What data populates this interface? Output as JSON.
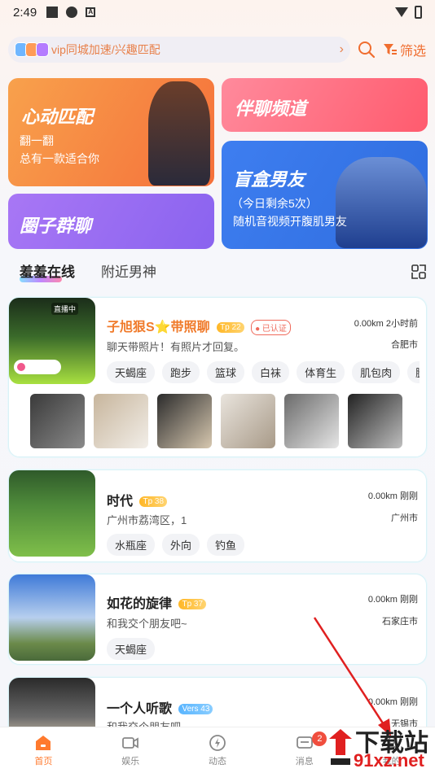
{
  "status_bar": {
    "time": "2:49",
    "small_icon": "A"
  },
  "search": {
    "text": "vip同城加速/兴趣匹配",
    "arrow": "›"
  },
  "filter": {
    "label": "筛选",
    "color": "#f06d2e"
  },
  "cards": {
    "heart_match": {
      "title": "心动匹配",
      "line1": "翻一翻",
      "line2": "总有一款适合你"
    },
    "chat_channel": {
      "title": "伴聊频道"
    },
    "blind_box": {
      "title": "盲盒男友",
      "line1": "（今日剩余5次）",
      "line2": "随机音视频开腹肌男友"
    },
    "circle_chat": {
      "title": "圈子群聊"
    }
  },
  "tabs": {
    "active": "羞羞在线",
    "inactive": "附近男神"
  },
  "users": [
    {
      "name": "子旭狠S⭐带照聊",
      "badge": "Tp",
      "level": "22",
      "certified": "已认证",
      "live": "直播中",
      "bio": "聊天带照片！有照片才回复。",
      "distance": "0.00km 2小时前",
      "city": "合肥市",
      "tags": [
        "天蝎座",
        "跑步",
        "篮球",
        "白袜",
        "体育生",
        "肌包肉",
        "腿"
      ]
    },
    {
      "name": "时代",
      "badge": "Tp",
      "level": "38",
      "bio": "广州市荔湾区，1",
      "distance": "0.00km 刚刚",
      "city": "广州市",
      "tags": [
        "水瓶座",
        "外向",
        "钓鱼"
      ]
    },
    {
      "name": "如花的旋律",
      "badge": "Tp",
      "level": "37",
      "bio": "和我交个朋友吧~",
      "distance": "0.00km 刚刚",
      "city": "石家庄市",
      "tags": [
        "天蝎座"
      ]
    },
    {
      "name": "一个人听歌",
      "badge": "Vers",
      "level": "43",
      "bio": "和我交个朋友吧~",
      "distance": "0.00km 刚刚",
      "city": "无锡市",
      "tags": []
    }
  ],
  "nav": [
    {
      "label": "首页",
      "icon": "home-icon",
      "active": true
    },
    {
      "label": "娱乐",
      "icon": "video-icon",
      "active": false
    },
    {
      "label": "动态",
      "icon": "lightning-icon",
      "active": false
    },
    {
      "label": "消息",
      "icon": "message-icon",
      "active": false,
      "badge": "2"
    },
    {
      "label": "我的",
      "icon": "profile-icon",
      "active": false
    }
  ],
  "watermark": {
    "line1": "下载站",
    "line2": "91xz.net"
  }
}
